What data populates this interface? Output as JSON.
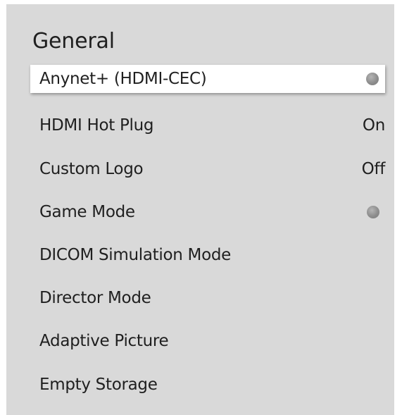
{
  "menu": {
    "title": "General",
    "items": [
      {
        "label": "Anynet+ (HDMI-CEC)",
        "value": "",
        "control": "toggle-off",
        "selected": true
      },
      {
        "label": "HDMI Hot Plug",
        "value": "On"
      },
      {
        "label": "Custom Logo",
        "value": "Off"
      },
      {
        "label": "Game Mode",
        "value": "",
        "control": "toggle-off"
      },
      {
        "label": "DICOM Simulation Mode",
        "value": ""
      },
      {
        "label": "Director Mode",
        "value": ""
      },
      {
        "label": "Adaptive Picture",
        "value": ""
      },
      {
        "label": "Empty Storage",
        "value": ""
      }
    ]
  },
  "colors": {
    "panel_background": "#d9d9d9",
    "selected_background": "#ffffff",
    "text": "#1f1f1f",
    "toggle": "#8d8d8d"
  }
}
